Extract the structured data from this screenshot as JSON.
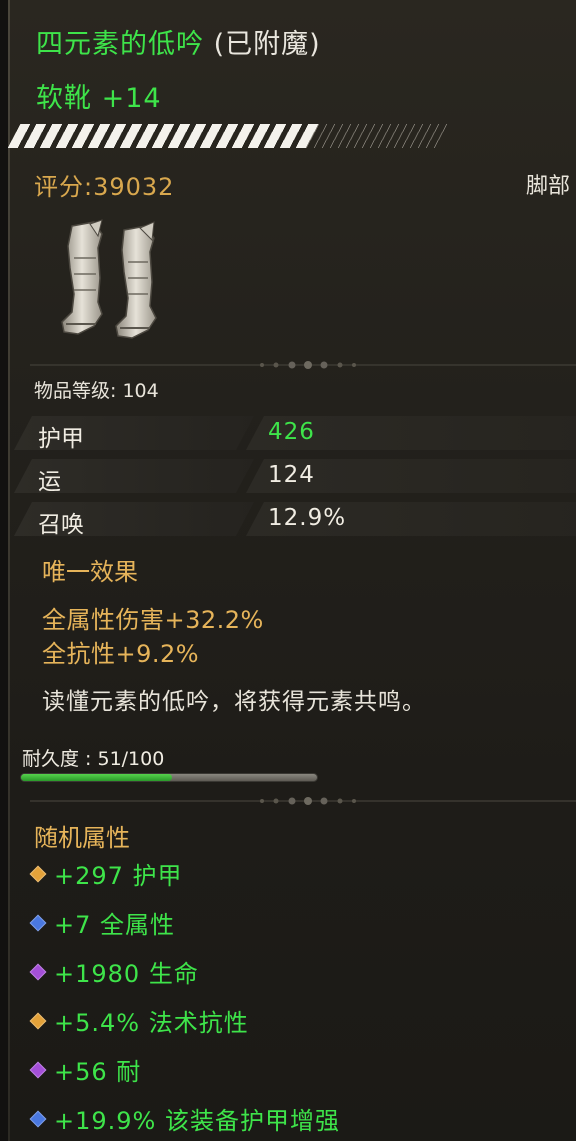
{
  "item": {
    "name": "四元素的低吟",
    "enchant_tag": " (已附魔)",
    "type_line": "软靴 +14",
    "upgrade_progress": 0.7,
    "score_label": "评分:39032",
    "slot": "脚部",
    "item_level": "物品等级: 104",
    "icon": "boots-icon"
  },
  "stats": [
    {
      "label": "护甲",
      "value": "426",
      "color": "green"
    },
    {
      "label": "运",
      "value": "124",
      "color": "white"
    },
    {
      "label": "召唤",
      "value": "12.9%",
      "color": "white"
    }
  ],
  "unique": {
    "title": "唯一效果",
    "lines": [
      "全属性伤害+32.2%",
      "全抗性+9.2%"
    ],
    "flavor": "读懂元素的低吟，将获得元素共鸣。"
  },
  "durability": {
    "label": "耐久度 : 51/100",
    "current": 51,
    "max": 100
  },
  "random": {
    "title": "随机属性",
    "items": [
      {
        "text": "+297 护甲",
        "gem_color": "#e3a23a"
      },
      {
        "text": "+7 全属性",
        "gem_color": "#4a78e0"
      },
      {
        "text": "+1980 生命",
        "gem_color": "#a44fd8"
      },
      {
        "text": "+5.4% 法术抗性",
        "gem_color": "#e3a23a"
      },
      {
        "text": "+56 耐",
        "gem_color": "#a44fd8"
      },
      {
        "text": "+19.9% 该装备护甲增强",
        "gem_color": "#4a78e0"
      }
    ]
  },
  "colors": {
    "name_green": "#3ee44a",
    "gold": "#e6b45a",
    "score_gold": "#d9a84e"
  }
}
